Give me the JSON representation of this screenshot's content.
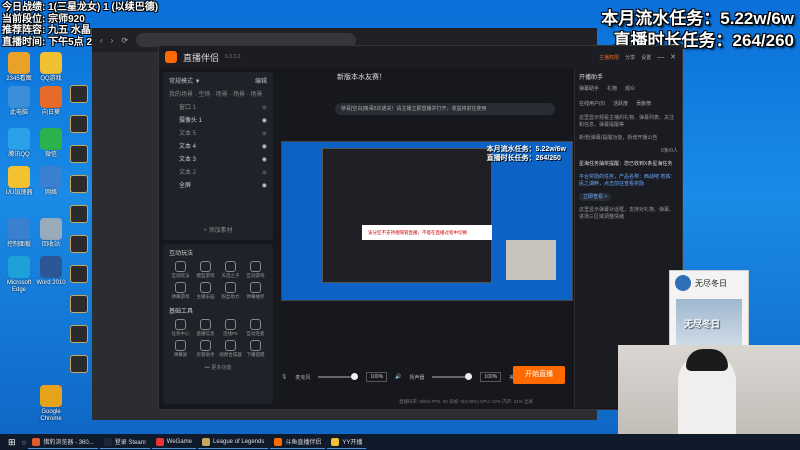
{
  "overlay": {
    "line1": "今日战绩: 1(三星龙女) 1 (以续巴德)",
    "line2": "当前段位: 宗师920",
    "line3": "推荐阵容: 九五 水晶",
    "line4": "直播时间: 下午5点 24点"
  },
  "tasks": {
    "flow": "本月流水任务：5.22w/6w",
    "duration": "直播时长任务：264/260"
  },
  "desktop_icons": [
    {
      "label": "2345看图",
      "color": "#e9a12a"
    },
    {
      "label": "QQ游戏",
      "color": "#f0c030"
    },
    {
      "label": "此电脑",
      "color": "#3a8fd8"
    },
    {
      "label": "向日葵",
      "color": "#e86a28"
    },
    {
      "label": "腾讯QQ",
      "color": "#2aa0e8"
    },
    {
      "label": "微信",
      "color": "#2bb24c"
    },
    {
      "label": "UU加速器",
      "color": "#f2c230"
    },
    {
      "label": "网络",
      "color": "#3b7fd0"
    },
    {
      "label": "控制面板",
      "color": "#3b7fd0"
    },
    {
      "label": "回收站",
      "color": "#9ab"
    },
    {
      "label": "Microsoft Edge",
      "color": "#1ea0d8"
    },
    {
      "label": "Word 2010",
      "color": "#2b5797"
    },
    {
      "label": "Google Chrome",
      "color": "#e5a21a"
    }
  ],
  "app": {
    "title": "直播伴侣",
    "version": "6.3.3.2",
    "stream_title": "新版本水友赛！",
    "notice": "恭喜[空白]吸毒5次通关！请主播立即直播并打开，收益将前往使用",
    "mode": "常规模式 ▼",
    "edit": "编辑",
    "scene_tabs": "我的场景 · 空场 · 场景 · 场景 · 场景",
    "sources": [
      {
        "label": "窗口 1",
        "on": false
      },
      {
        "label": "摄像头 1",
        "on": true
      },
      {
        "label": "文本 5",
        "on": false
      },
      {
        "label": "文本 4",
        "on": true
      },
      {
        "label": "文本 3",
        "on": true
      },
      {
        "label": "文本 2",
        "on": false
      },
      {
        "label": "全屏",
        "on": true
      }
    ],
    "add_source": "+ 添加素材",
    "interact_title": "互动玩法",
    "interact_items": [
      "互动玩法",
      "模型游戏",
      "天选之子",
      "互动游戏",
      "弹幕游戏",
      "主播乐园",
      "粉丝助力",
      "弹幕抽奖"
    ],
    "basic_title": "基础工具",
    "basic_items": [
      "任务中心",
      "直播信息",
      "连线PK",
      "互动连麦",
      "弹幕屏",
      "房管助手",
      "视频合成器",
      "下播提醒"
    ],
    "more": "••• 更多功能",
    "mic_label": "麦克风",
    "mic_pct": "100%",
    "speaker_label": "扬声器",
    "speaker_pct": "100%",
    "ctrl_items": [
      "美颜",
      "录制",
      "设置"
    ],
    "start_button": "开始直播",
    "status": "直播码率: 0kb/s   FPS: 60   丢帧: 0(0.00%)   CPU: 22%   内存: 31%   全屏",
    "top_right": [
      "主播权限",
      "分享",
      "设置"
    ],
    "viewers": "567409",
    "likes": "103516"
  },
  "preview": {
    "stat1": "本月流水任务：5.22w/6w",
    "stat2": "直播时长任务：264/260",
    "dialog": "该分区不支持相隔管直播，不能在直播过程中切换"
  },
  "right_panel": {
    "header": "开播助手",
    "tabs": [
      "弹幕助手",
      "礼物",
      "观众"
    ],
    "sub_tabs": [
      "在线用户(0)",
      "活跃度",
      "贡献榜"
    ],
    "p1": "这里显示观看主播的礼物、弹幕列表、关注和信息、弹幕提醒等",
    "p2": "新增(弹幕)提醒功能，新增开播公告",
    "p3": "星海任务抽奖提醒：您已收到X条星海任务",
    "hl": "平台奖励的任务，产品名称：西战吧 地铁：民之湖畔，点击前往查看奖励",
    "btn": "立即查看 >",
    "p4": "这里显示弹幕对话框，支持对礼物、弹幕、进场三区域调整情绪",
    "counter": "0条/0人"
  },
  "taskbar": [
    {
      "label": "猎豹浏览器 - 360...",
      "color": "#e05a2a"
    },
    {
      "label": "登录 Steam",
      "color": "#1b2838"
    },
    {
      "label": "WeGame",
      "color": "#e33"
    },
    {
      "label": "League of Legends",
      "color": "#c8a85a"
    },
    {
      "label": "斗鱼直播伴侣",
      "color": "#ff6a00"
    },
    {
      "label": "YY开播",
      "color": "#f2c230"
    }
  ],
  "profile": {
    "name": "无尽冬日",
    "cover_text": "无尽冬日"
  }
}
